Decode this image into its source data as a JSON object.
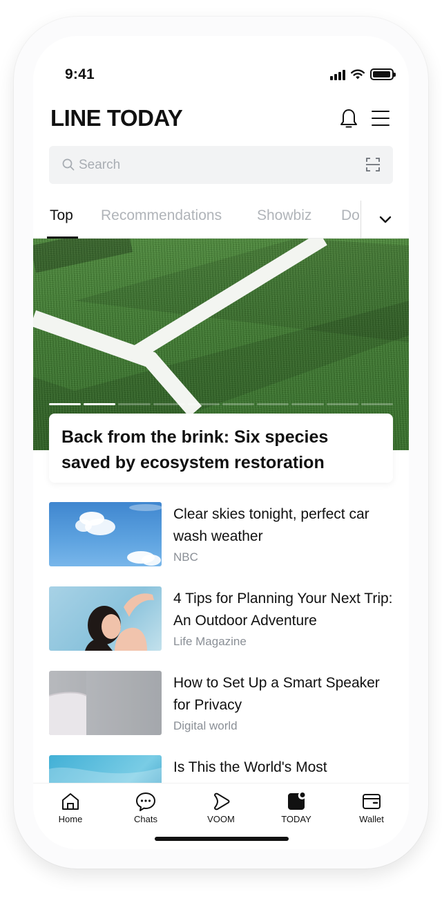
{
  "status_bar": {
    "time": "9:41"
  },
  "header": {
    "title": "LINE TODAY",
    "bell_icon": "bell-icon",
    "menu_icon": "hamburger-menu-icon"
  },
  "search": {
    "placeholder": "Search",
    "value": "",
    "scan_icon": "scan-icon"
  },
  "tabs": [
    {
      "label": "Top",
      "active": true
    },
    {
      "label": "Recommendations",
      "active": false
    },
    {
      "label": "Showbiz",
      "active": false
    },
    {
      "label": "Do",
      "active": false
    }
  ],
  "hero": {
    "title": "Back from the brink: Six species saved by ecosystem restoration",
    "slides_total": 10,
    "slide_active": 2
  },
  "articles": [
    {
      "title": "Clear skies tonight, perfect car wash weather",
      "source": "NBC"
    },
    {
      "title": "4 Tips for Planning Your Next Trip: An Outdoor Adventure",
      "source": "Life Magazine"
    },
    {
      "title": "How to Set Up a Smart Speaker for Privacy",
      "source": "Digital world"
    },
    {
      "title": "Is This the World's Most",
      "source": ""
    }
  ],
  "bottom_nav": [
    {
      "label": "Home",
      "icon": "home-icon"
    },
    {
      "label": "Chats",
      "icon": "chat-icon"
    },
    {
      "label": "VOOM",
      "icon": "voom-icon"
    },
    {
      "label": "TODAY",
      "icon": "today-icon",
      "active": true
    },
    {
      "label": "Wallet",
      "icon": "wallet-icon"
    }
  ],
  "colors": {
    "accent": "#111111",
    "inactive_tab": "#b0b4b9",
    "source_text": "#8a8f96",
    "search_bg": "#f2f3f4"
  }
}
